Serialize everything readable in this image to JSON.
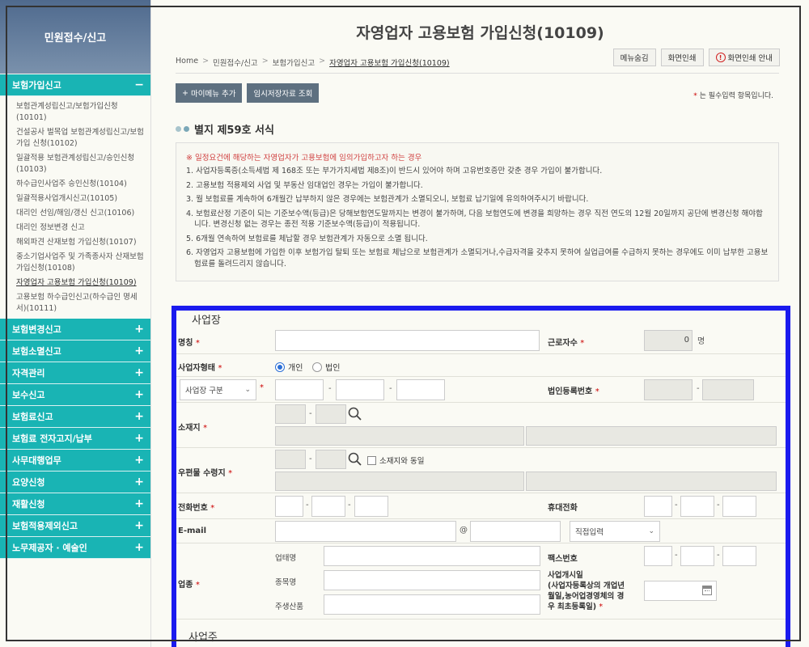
{
  "sidebar": {
    "header": "민원접수/신고",
    "open_group": "보험가입신고",
    "open_sign": "−",
    "subitems": [
      "보험관계성립신고/보험가입신청(10101)",
      "건설공사 벌목업 보험관계성립신고/보험가입 신청(10102)",
      "일괄적용 보험관계성립신고/승인신청(10103)",
      "하수급인사업주 승인신청(10104)",
      "일괄적용사업개시신고(10105)",
      "대리인 선임/해임/갱신 신고(10106)",
      "대리인 정보변경 신고",
      "해외파견 산재보험 가입신청(10107)",
      "중소기업사업주 및 가족종사자 산재보험가입신청(10108)",
      "자영업자 고용보험 가입신청(10109)",
      "고용보험 하수급인신고(하수급인 명세서)(10111)"
    ],
    "groups": [
      "보험변경신고",
      "보험소멸신고",
      "자격관리",
      "보수신고",
      "보험료신고",
      "보험료 전자고지/납부",
      "사무대행업무",
      "요양신청",
      "재활신청",
      "보험적용제외신고",
      "노무제공자 · 예술인"
    ],
    "plus": "+"
  },
  "main": {
    "title": "자영업자 고용보험 가입신청(10109)",
    "breadcrumb": [
      "Home",
      "민원접수/신고",
      "보험가입신고",
      "자영업자 고용보험 가입신청(10109)"
    ],
    "breadcrumb_sep": ">",
    "top_buttons": [
      "메뉴숨김",
      "화면인쇄",
      "화면인쇄 안내"
    ],
    "alert_glyph": "!",
    "action_buttons": {
      "add_menu": "마이메뉴 추가",
      "plus": "+",
      "temp_view": "임시저장자료 조회"
    },
    "required_note": {
      "star": "*",
      "text": "는 필수입력 항목입니다."
    },
    "form_title": "별지 제59호 서식",
    "notice": {
      "head": "※ 일정요건에 해당하는 자영업자가 고용보험에 임의가입하고자 하는 경우",
      "items": [
        "1. 사업자등록증(소득세법 제 168조 또는 부가가치세법 제8조)이 반드시 있어야 하며 고유번호증만 갖춘 경우 가입이 불가합니다.",
        "2. 고용보험 적용제외 사업 및 부동산 임대업인 경우는 가입이 불가합니다.",
        "3. 월 보험료를 계속하여 6개월간 납부하지 않은 경우에는 보험관계가 소멸되오니, 보험료 납기일에 유의하여주시기 바랍니다.",
        "4. 보험료산정 기준이 되는 기준보수액(등급)은 당해보험연도말까지는 변경이 불가하며, 다음 보험연도에 변경을 희망하는 경우 직전 연도의 12월 20일까지 공단에 변경신청 해야합니다. 변경신청 없는 경우는 종전 적용 기준보수액(등급)이 적용됩니다.",
        "5. 6개월 연속하여 보험료를 체납할 경우 보험관계가 자동으로 소멸 됩니다.",
        "6. 자영업자 고용보험에 가입한 이후 보험가입 탈퇴 또는 보험료 체납으로 보험관계가 소멸되거나,수급자격을 갖추지 못하여 실업급여를 수급하지 못하는 경우에도 이미 납부한 고용보험료를 돌려드리지 않습니다."
      ]
    }
  },
  "form": {
    "section1": "사업장",
    "section2": "사업주",
    "star": "*",
    "name_label": "명칭",
    "workers_label": "근로자수",
    "workers_value": "0",
    "workers_unit": "명",
    "type_label": "사업자형태",
    "type_options": [
      "개인",
      "법인"
    ],
    "biz_select": "사업장 구분",
    "corp_no_label": "법인등록번호",
    "address_label": "소재지",
    "mail_address_label": "우편물 수령지",
    "same_as_address": "소재지와 동일",
    "phone_label": "전화번호",
    "mobile_label": "휴대전화",
    "email_label": "E-mail",
    "at": "@",
    "email_select": "직접입력",
    "industry_label": "업종",
    "sub_labels": [
      "업태명",
      "종목명",
      "주생산품"
    ],
    "fax_label": "팩스번호",
    "start_label": [
      "사업개시일",
      "(사업자등록상의 개업년",
      "월일,농어업경영체의 경",
      "우 최초등록일)"
    ],
    "dash": "-"
  }
}
